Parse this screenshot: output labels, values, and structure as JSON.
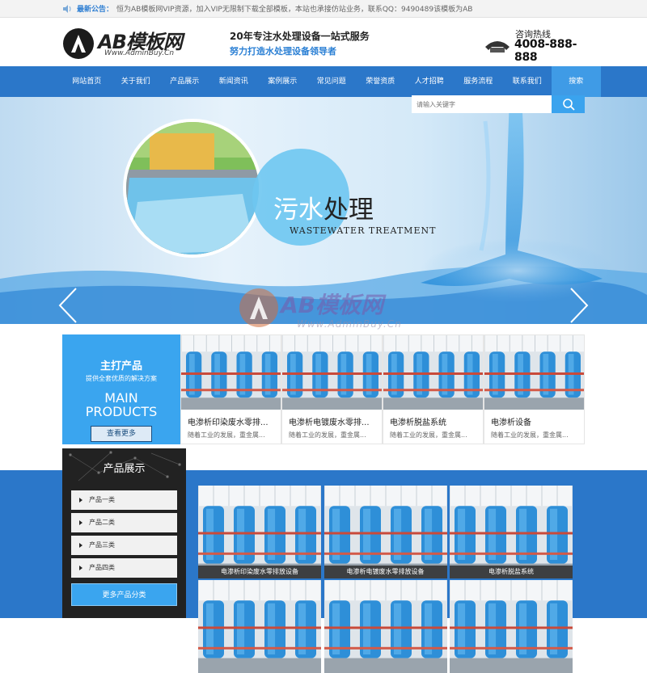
{
  "notice": {
    "label": "最新公告：",
    "text": "恒为AB模板网VIP资源，加入VIP无限制下载全部模板，本站也承接仿站业务，联系QQ：9490489该模板为AB"
  },
  "header": {
    "logo_text": "AB模板网",
    "logo_url": "Www.AdminBuy.Cn",
    "slogan_main": "20年专注水处理设备一站式服务",
    "slogan_sub": "努力打造水处理设备领导者",
    "hotline_label": "咨询热线",
    "hotline_number": "4008-888-888"
  },
  "nav": {
    "items": [
      "网站首页",
      "关于我们",
      "产品展示",
      "新闻资讯",
      "案例展示",
      "常见问题",
      "荣誉资质",
      "人才招聘",
      "服务流程",
      "联系我们",
      "搜索"
    ],
    "active_index": 10
  },
  "search": {
    "placeholder": "请输入关键字"
  },
  "banner": {
    "title_a": "污水",
    "title_b": "处理",
    "subtitle": "WASTEWATER TREATMENT"
  },
  "watermark": {
    "text": "AB模板网",
    "url": "Www.AdminBuy.Cn"
  },
  "main_products": {
    "title": "主打产品",
    "subtitle": "提供全套优质的解决方案",
    "en_line1": "MAIN",
    "en_line2": "PRODUCTS",
    "more": "查看更多"
  },
  "featured": [
    {
      "title": "电渗析印染废水零排...",
      "desc": "随着工业的发展，重金属..."
    },
    {
      "title": "电渗析电镀废水零排...",
      "desc": "随着工业的发展，重金属..."
    },
    {
      "title": "电渗析脱盐系统",
      "desc": "随着工业的发展，重金属..."
    },
    {
      "title": "电渗析设备",
      "desc": "随着工业的发展，重金属..."
    }
  ],
  "sidebar": {
    "title": "产品展示",
    "categories": [
      "产品一类",
      "产品二类",
      "产品三类",
      "产品四类"
    ],
    "more": "更多产品分类"
  },
  "products": [
    {
      "caption": "电渗析印染废水零排放设备"
    },
    {
      "caption": "电渗析电镀废水零排放设备"
    },
    {
      "caption": "电渗析脱盐系统"
    },
    {
      "caption": ""
    },
    {
      "caption": ""
    },
    {
      "caption": ""
    }
  ],
  "colors": {
    "brand_blue": "#2b77c9",
    "accent_blue": "#3aa5ef",
    "dark": "#222222"
  }
}
